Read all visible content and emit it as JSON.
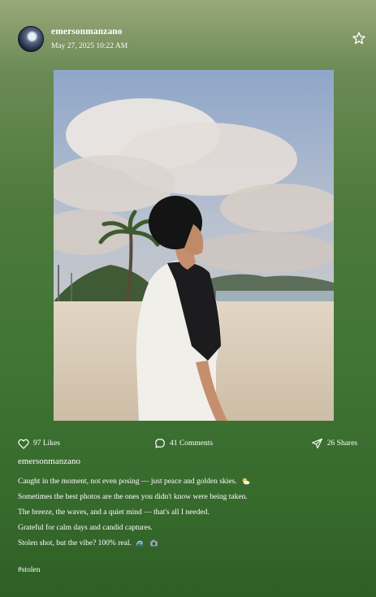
{
  "post": {
    "username": "emersonmanzano",
    "timestamp": "May 27, 2025 10:22 AM",
    "favorite_icon": "star-outline-icon",
    "photo_description": "beach-portrait"
  },
  "actions": {
    "likes": {
      "icon": "heart-icon",
      "label": "97 Likes"
    },
    "comments": {
      "icon": "comment-icon",
      "label": "41 Comments"
    },
    "shares": {
      "icon": "send-icon",
      "label": "26 Shares"
    }
  },
  "caption": {
    "username": "emersonmanzano",
    "lines": [
      "Caught in the moment, not even posing — just peace and golden skies.",
      "Sometimes the best photos are the ones you didn't know were being taken.",
      "The breeze, the waves, and a quiet mind — that's all I needed.",
      "Grateful for calm days and candid captures.",
      "Stolen shot, but the vibe? 100% real."
    ],
    "hashtag": "#stolen"
  },
  "colors": {
    "background_top": "#9aa87a",
    "background_bottom": "#2e5f25",
    "text": "#ffffff"
  }
}
